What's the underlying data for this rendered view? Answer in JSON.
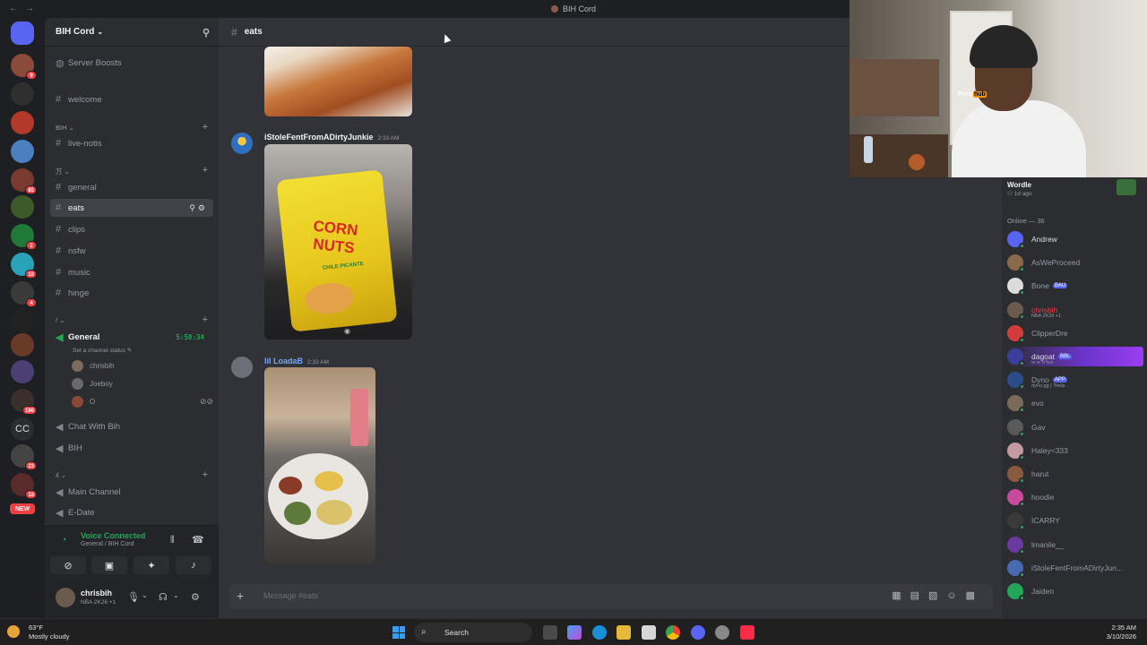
{
  "window": {
    "title": "BIH Cord"
  },
  "servers": {
    "badges": [
      "9",
      "85",
      "2",
      "18",
      "4",
      "196",
      "23",
      "18",
      "24"
    ],
    "cc_label": "CC",
    "new_label": "NEW"
  },
  "server": {
    "name": "BIH Cord",
    "boosts_label": "Server Boosts",
    "categories": [
      "BIH",
      "万",
      "/",
      "ʎ"
    ],
    "channels": {
      "welcome": "welcome",
      "live_notis": "live-notis",
      "general": "general",
      "eats": "eats",
      "clips": "clips",
      "nsfw": "nsfw",
      "music": "music",
      "hinge": "hinge",
      "voice_general": "General",
      "voice_general_status": "Set a channel status",
      "voice_timer": "5:50:34",
      "chat_with_bih": "Chat With Bih",
      "bih": "BIH",
      "main_channel": "Main Channel",
      "e_date": "E-Date"
    },
    "voice_users": [
      "chrisbih",
      "Joeboy",
      "O"
    ]
  },
  "voice_panel": {
    "title": "Voice Connected",
    "subtitle": "General / BIH Cord"
  },
  "user_panel": {
    "name": "chrisbih",
    "status": "NBA 2K26 +1"
  },
  "channel": {
    "name": "eats",
    "composer_placeholder": "Message #eats",
    "messages": [
      {
        "author": "iStoleFentFromADirtyJunkie",
        "time": "2:33 AM"
      },
      {
        "author": "lil LoadaB",
        "time": "2:33 AM"
      }
    ],
    "snack_text": "CORN NUTS",
    "snack_flavor": "CHILE PICANTE"
  },
  "members": {
    "activity_title": "Wordle",
    "activity_sub": "1d ago",
    "online_header": "Online — 36",
    "list": [
      {
        "name": "Andrew"
      },
      {
        "name": "AsWeProceed"
      },
      {
        "name": "Bone",
        "tag": "BAU"
      },
      {
        "name": "chrisbih",
        "sub": "NBA 2K26 +1"
      },
      {
        "name": "ClipperDre"
      },
      {
        "name": "dagoat",
        "tag": "BBL",
        "sub": "w or b*tch"
      },
      {
        "name": "Dyno",
        "tag": "APP",
        "sub": "dyno.gg | ?help"
      },
      {
        "name": "evo"
      },
      {
        "name": "Gav"
      },
      {
        "name": "Haley<333"
      },
      {
        "name": "harut"
      },
      {
        "name": "hoodie"
      },
      {
        "name": "ICARRY"
      },
      {
        "name": "lmanile__"
      },
      {
        "name": "iStoleFentFromADirtyJun..."
      },
      {
        "name": "Jaiden"
      }
    ]
  },
  "webcam": {
    "shirt_logo_a": "Porn",
    "shirt_logo_b": "hub"
  },
  "taskbar": {
    "temp": "63°F",
    "condition": "Mostly cloudy",
    "search": "Search",
    "time": "2:35 AM",
    "date": "3/10/2026"
  },
  "colors": {
    "accent": "#5865f2",
    "online": "#23a55a",
    "danger": "#f23f43"
  }
}
